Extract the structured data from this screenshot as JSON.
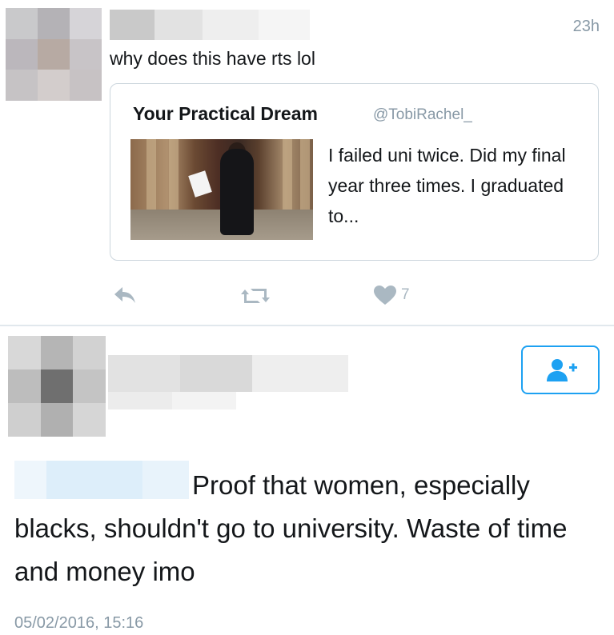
{
  "tweet1": {
    "time": "23h",
    "text": "why does this have rts lol",
    "quoted": {
      "name": "Your Practical Dream",
      "handle": "@TobiRachel_",
      "text": "I failed uni twice. Did my final year three times. I graduated to..."
    },
    "actions": {
      "reply_icon": "reply-icon",
      "retweet_icon": "retweet-icon",
      "like_icon": "heart-icon",
      "like_count": "7"
    }
  },
  "tweet2": {
    "follow_icon": "add-user-icon",
    "text_line1": "Proof that women, especially",
    "text_rest": "blacks, shouldn't go to university. Waste of time and money imo",
    "timestamp": "05/02/2016, 15:16"
  },
  "colors": {
    "accent": "#1da1f2",
    "muted": "#8899a6",
    "border": "#ccd6dd",
    "icon": "#aab8c2"
  }
}
